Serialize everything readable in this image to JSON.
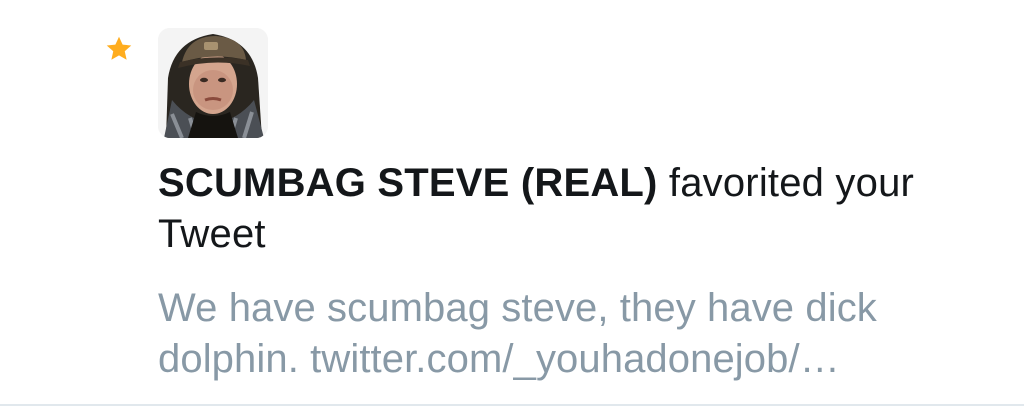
{
  "notification": {
    "type_icon": "star-icon",
    "actor_name": "SCUMBAG STEVE (REAL)",
    "action_text": "favorited your Tweet",
    "tweet_preview": "We have scumbag steve, they have dick dolphin. twitter.com/_youhadonejob/…"
  },
  "colors": {
    "star": "#ffad1f",
    "actor_text": "#14171a",
    "preview_text": "#8899a6",
    "divider": "#e1e8ed"
  }
}
